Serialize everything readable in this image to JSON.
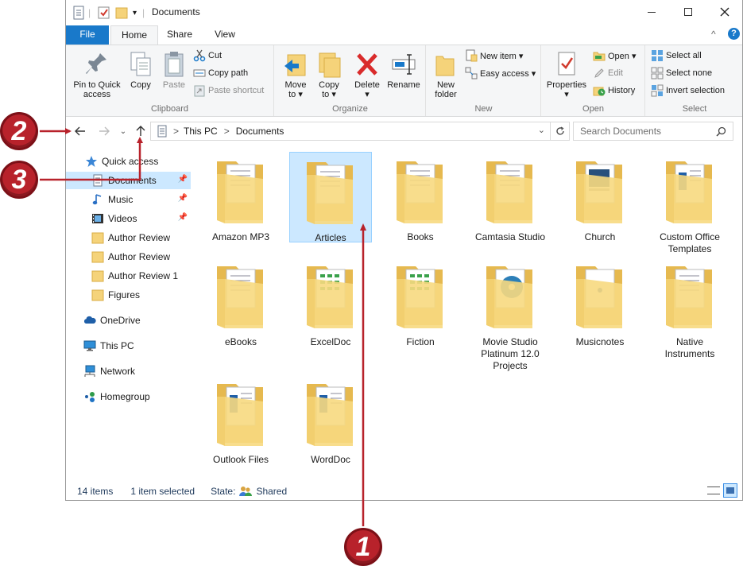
{
  "window": {
    "title": "Documents"
  },
  "tabs": [
    {
      "label": "File"
    },
    {
      "label": "Home"
    },
    {
      "label": "Share"
    },
    {
      "label": "View"
    }
  ],
  "ribbon": {
    "clipboard": {
      "label": "Clipboard",
      "pin_to_quick_access": "Pin to Quick access",
      "pin_line1": "Pin to Quick",
      "pin_line2": "access",
      "copy": "Copy",
      "paste": "Paste",
      "cut": "Cut",
      "copy_path": "Copy path",
      "paste_shortcut": "Paste shortcut"
    },
    "organize": {
      "label": "Organize",
      "move_to_line1": "Move",
      "move_to_line2": "to ▾",
      "copy_to_line1": "Copy",
      "copy_to_line2": "to ▾",
      "delete_line1": "Delete",
      "delete_line2": "▾",
      "rename": "Rename"
    },
    "new": {
      "label": "New",
      "new_folder_line1": "New",
      "new_folder_line2": "folder",
      "new_item": "New item ▾",
      "easy_access": "Easy access ▾"
    },
    "open": {
      "label": "Open",
      "properties": "Properties",
      "properties_arrow": "▾",
      "open": "Open ▾",
      "edit": "Edit",
      "history": "History"
    },
    "select": {
      "label": "Select",
      "select_all": "Select all",
      "select_none": "Select none",
      "invert_selection": "Invert selection"
    }
  },
  "address_bar": {
    "crumbs": [
      "This PC",
      "Documents"
    ],
    "separator": ">"
  },
  "search": {
    "placeholder": "Search Documents"
  },
  "nav_pane": {
    "items": [
      {
        "label": "Quick access",
        "icon": "star-icon"
      },
      {
        "label": "Documents",
        "icon": "documents-icon",
        "pinned": true,
        "selected": true
      },
      {
        "label": "Music",
        "icon": "music-icon",
        "pinned": true
      },
      {
        "label": "Videos",
        "icon": "videos-icon",
        "pinned": true
      },
      {
        "label": "Author Review",
        "icon": "folder-icon"
      },
      {
        "label": "Author Review",
        "icon": "folder-icon"
      },
      {
        "label": "Author Review 1",
        "icon": "folder-icon"
      },
      {
        "label": "Figures",
        "icon": "folder-icon"
      },
      {
        "label": "OneDrive",
        "icon": "cloud-icon"
      },
      {
        "label": "This PC",
        "icon": "computer-icon"
      },
      {
        "label": "Network",
        "icon": "network-icon"
      },
      {
        "label": "Homegroup",
        "icon": "homegroup-icon"
      }
    ]
  },
  "folders": [
    {
      "name": "Amazon MP3",
      "line2": ""
    },
    {
      "name": "Articles",
      "line2": "",
      "selected": true
    },
    {
      "name": "Books",
      "line2": ""
    },
    {
      "name": "Camtasia Studio",
      "line2": ""
    },
    {
      "name": "Church",
      "line2": ""
    },
    {
      "name": "Custom Office",
      "line2": "Templates"
    },
    {
      "name": "eBooks",
      "line2": ""
    },
    {
      "name": "ExcelDoc",
      "line2": ""
    },
    {
      "name": "Fiction",
      "line2": ""
    },
    {
      "name": "Movie Studio",
      "line2": "Platinum 12.0",
      "line3": "Projects"
    },
    {
      "name": "Musicnotes",
      "line2": ""
    },
    {
      "name": "Native",
      "line2": "Instruments"
    },
    {
      "name": "Outlook Files",
      "line2": ""
    },
    {
      "name": "WordDoc",
      "line2": ""
    }
  ],
  "status_bar": {
    "item_count": "14 items",
    "selected": "1 item selected",
    "state_label": "State:",
    "state_value": "Shared"
  },
  "callouts": [
    "1",
    "2",
    "3"
  ],
  "colors": {
    "accent": "#1979ca",
    "selection": "#cce8ff",
    "callout": "#b8222b",
    "folder": "#f5d37a"
  }
}
